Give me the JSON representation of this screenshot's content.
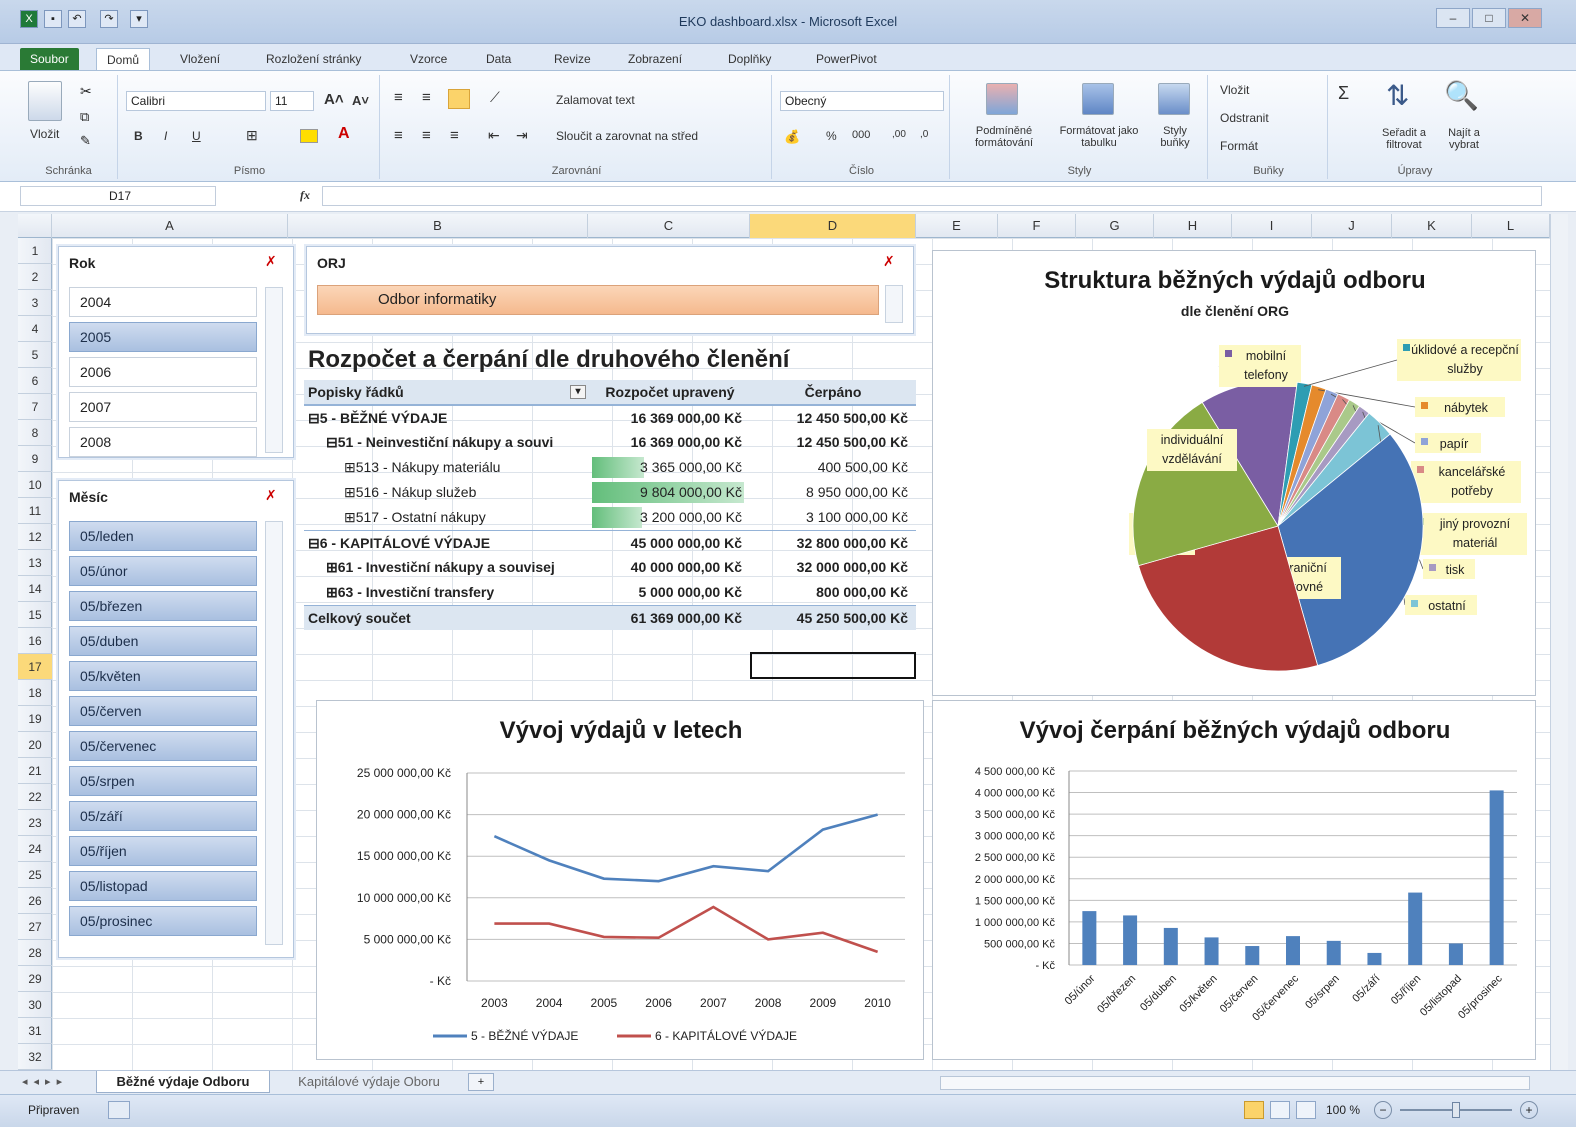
{
  "window": {
    "title": "EKO dashboard.xlsx - Microsoft Excel"
  },
  "tabs": [
    "Soubor",
    "Domů",
    "Vložení",
    "Rozložení stránky",
    "Vzorce",
    "Data",
    "Revize",
    "Zobrazení",
    "Doplňky",
    "PowerPivot"
  ],
  "ribbon": {
    "paste": "Vložit",
    "clipboard": "Schránka",
    "font_name": "Calibri",
    "font_size": "11",
    "font_group": "Písmo",
    "bold": "B",
    "italic": "I",
    "underline": "U",
    "wrap_text": "Zalamovat text",
    "merge": "Sloučit a zarovnat na střed",
    "align_group": "Zarovnání",
    "number_format": "Obecný",
    "number_group": "Číslo",
    "cond_format": "Podmíněné formátování",
    "format_table": "Formátovat jako tabulku",
    "cell_styles": "Styly buňky",
    "styles_group": "Styly",
    "insert": "Vložit",
    "delete": "Odstranit",
    "format": "Formát",
    "cells_group": "Buňky",
    "sort": "Seřadit a filtrovat",
    "find": "Najít a vybrat",
    "edit_group": "Úpravy"
  },
  "formula_bar": {
    "name_box": "D17",
    "fx": "fx",
    "value": ""
  },
  "columns": [
    "A",
    "B",
    "C",
    "D",
    "E",
    "F",
    "G",
    "H",
    "I",
    "J",
    "K",
    "L"
  ],
  "rows": [
    "1",
    "2",
    "3",
    "4",
    "5",
    "6",
    "7",
    "8",
    "9",
    "10",
    "11",
    "12",
    "13",
    "14",
    "15",
    "16",
    "17",
    "18",
    "19",
    "20",
    "21",
    "22",
    "23",
    "24",
    "25",
    "26",
    "27",
    "28",
    "29",
    "30",
    "31",
    "32"
  ],
  "slicer_year": {
    "title": "Rok",
    "items": [
      {
        "label": "2004",
        "on": false
      },
      {
        "label": "2005",
        "on": true
      },
      {
        "label": "2006",
        "on": false
      },
      {
        "label": "2007",
        "on": false
      },
      {
        "label": "2008",
        "on": false
      }
    ]
  },
  "slicer_month": {
    "title": "Měsíc",
    "items": [
      "05/leden",
      "05/únor",
      "05/březen",
      "05/duben",
      "05/květen",
      "05/červen",
      "05/červenec",
      "05/srpen",
      "05/září",
      "05/říjen",
      "05/listopad",
      "05/prosinec"
    ]
  },
  "slicer_org": {
    "title": "ORJ",
    "selected": "Odbor informatiky"
  },
  "pivot": {
    "title": "Rozpočet a čerpání dle druhového členění",
    "headers": [
      "Popisky řádků",
      "Rozpočet upravený",
      "Čerpáno"
    ],
    "rows": [
      {
        "label": "⊟5 - BĚŽNÉ VÝDAJE",
        "budget": "16 369 000,00 Kč",
        "spent": "12 450 500,00 Kč",
        "indent": 0,
        "bold": true
      },
      {
        "label": "⊟51 - Neinvestiční nákupy a souvi",
        "budget": "16 369 000,00 Kč",
        "spent": "12 450 500,00 Kč",
        "indent": 1,
        "bold": true
      },
      {
        "label": "⊞513 - Nákupy materiálu",
        "budget": "3 365 000,00 Kč",
        "spent": "400 500,00 Kč",
        "indent": 2,
        "bold": false,
        "bar": 0.34
      },
      {
        "label": "⊞516 - Nákup služeb",
        "budget": "9 804 000,00 Kč",
        "spent": "8 950 000,00 Kč",
        "indent": 2,
        "bold": false,
        "bar": 1.0
      },
      {
        "label": "⊞517 - Ostatní nákupy",
        "budget": "3 200 000,00 Kč",
        "spent": "3 100 000,00 Kč",
        "indent": 2,
        "bold": false,
        "bar": 0.33
      },
      {
        "label": "⊟6 - KAPITÁLOVÉ VÝDAJE",
        "budget": "45 000 000,00 Kč",
        "spent": "32 800 000,00 Kč",
        "indent": 0,
        "bold": true
      },
      {
        "label": "⊞61 - Investiční nákupy a souvisej",
        "budget": "40 000 000,00 Kč",
        "spent": "32 000 000,00 Kč",
        "indent": 1,
        "bold": true
      },
      {
        "label": "⊞63 - Investiční transfery",
        "budget": "5 000 000,00 Kč",
        "spent": "800 000,00 Kč",
        "indent": 1,
        "bold": true
      }
    ],
    "total": {
      "label": "Celkový součet",
      "budget": "61 369 000,00 Kč",
      "spent": "45 250 500,00 Kč"
    }
  },
  "pie": {
    "title": "Struktura běžných výdajů odboru",
    "subtitle": "dle členění ORG",
    "slices": [
      {
        "name": "mobilní telefony",
        "value": 10,
        "color": "#7a5ea3"
      },
      {
        "name": "úklidové a recepční služby",
        "value": 1.5,
        "color": "#2e9db3"
      },
      {
        "name": "nábytek",
        "value": 1.5,
        "color": "#e58a2c"
      },
      {
        "name": "papír",
        "value": 1.3,
        "color": "#8fa3d8"
      },
      {
        "name": "kancelářské potřeby",
        "value": 1.3,
        "color": "#d98a86"
      },
      {
        "name": "jiný provozní materiál",
        "value": 1.2,
        "color": "#aac98a"
      },
      {
        "name": "tisk",
        "value": 1.2,
        "color": "#a79ac2"
      },
      {
        "name": "ostatní",
        "value": 3,
        "color": "#7cc4d6"
      },
      {
        "name": "zahraniční cestovné",
        "value": 29,
        "color": "#4573b5"
      },
      {
        "name": "domácí cestovné",
        "value": 23,
        "color": "#b23a38"
      },
      {
        "name": "individuální vzdělávání",
        "value": 19,
        "color": "#8aab44"
      }
    ]
  },
  "line": {
    "title": "Vývoj výdajů v letech",
    "x": [
      "2003",
      "2004",
      "2005",
      "2006",
      "2007",
      "2008",
      "2009",
      "2010"
    ],
    "yticks": [
      "25 000 000,00 Kč",
      "20 000 000,00 Kč",
      "15 000 000,00 Kč",
      "10 000 000,00 Kč",
      "5 000 000,00 Kč",
      "- Kč"
    ],
    "series": [
      {
        "name": "5 - BĚŽNÉ VÝDAJE",
        "color": "#4f81bd",
        "values": [
          17400000,
          14500000,
          12300000,
          12000000,
          13800000,
          13200000,
          18200000,
          20000000
        ]
      },
      {
        "name": "6 - KAPITÁLOVÉ VÝDAJE",
        "color": "#c0504d",
        "values": [
          6900000,
          6900000,
          5300000,
          5200000,
          8900000,
          5000000,
          5800000,
          3500000
        ]
      }
    ]
  },
  "bar": {
    "title": "Vývoj čerpání běžných výdajů odboru",
    "categories": [
      "05/únor",
      "05/březen",
      "05/duben",
      "05/květen",
      "05/červen",
      "05/červenec",
      "05/srpen",
      "05/září",
      "05/říjen",
      "05/listopad",
      "05/prosinec"
    ],
    "values": [
      1250000,
      1150000,
      860000,
      640000,
      440000,
      670000,
      560000,
      280000,
      1680000,
      500000,
      4050000
    ],
    "yticks": [
      "4 500 000,00 Kč",
      "4 000 000,00 Kč",
      "3 500 000,00 Kč",
      "3 000 000,00 Kč",
      "2 500 000,00 Kč",
      "2 000 000,00 Kč",
      "1 500 000,00 Kč",
      "1 000 000,00 Kč",
      "500 000,00 Kč",
      "- Kč"
    ],
    "color": "#4f81bd"
  },
  "chart_data": [
    {
      "type": "pie",
      "title": "Struktura běžných výdajů odboru",
      "subtitle": "dle členění ORG",
      "categories": [
        "mobilní telefony",
        "úklidové a recepční služby",
        "nábytek",
        "papír",
        "kancelářské potřeby",
        "jiný provozní materiál",
        "tisk",
        "ostatní",
        "zahraniční cestovné",
        "domácí cestovné",
        "individuální vzdělávání"
      ],
      "values": [
        10,
        1.5,
        1.5,
        1.3,
        1.3,
        1.2,
        1.2,
        3,
        29,
        23,
        19
      ]
    },
    {
      "type": "line",
      "title": "Vývoj výdajů v letech",
      "x": [
        "2003",
        "2004",
        "2005",
        "2006",
        "2007",
        "2008",
        "2009",
        "2010"
      ],
      "ylim": [
        0,
        25000000
      ],
      "series": [
        {
          "name": "5 - BĚŽNÉ VÝDAJE",
          "values": [
            17400000,
            14500000,
            12300000,
            12000000,
            13800000,
            13200000,
            18200000,
            20000000
          ]
        },
        {
          "name": "6 - KAPITÁLOVÉ VÝDAJE",
          "values": [
            6900000,
            6900000,
            5300000,
            5200000,
            8900000,
            5000000,
            5800000,
            3500000
          ]
        }
      ]
    },
    {
      "type": "bar",
      "title": "Vývoj čerpání běžných výdajů odboru",
      "categories": [
        "05/únor",
        "05/březen",
        "05/duben",
        "05/květen",
        "05/červen",
        "05/červenec",
        "05/srpen",
        "05/září",
        "05/říjen",
        "05/listopad",
        "05/prosinec"
      ],
      "values": [
        1250000,
        1150000,
        860000,
        640000,
        440000,
        670000,
        560000,
        280000,
        1680000,
        500000,
        4050000
      ],
      "ylim": [
        0,
        4500000
      ]
    }
  ],
  "sheets": [
    {
      "label": "Běžné výdaje Odboru",
      "active": true
    },
    {
      "label": "Kapitálové výdaje Oboru",
      "active": false
    }
  ],
  "status": {
    "ready": "Připraven",
    "zoom": "100 %"
  }
}
